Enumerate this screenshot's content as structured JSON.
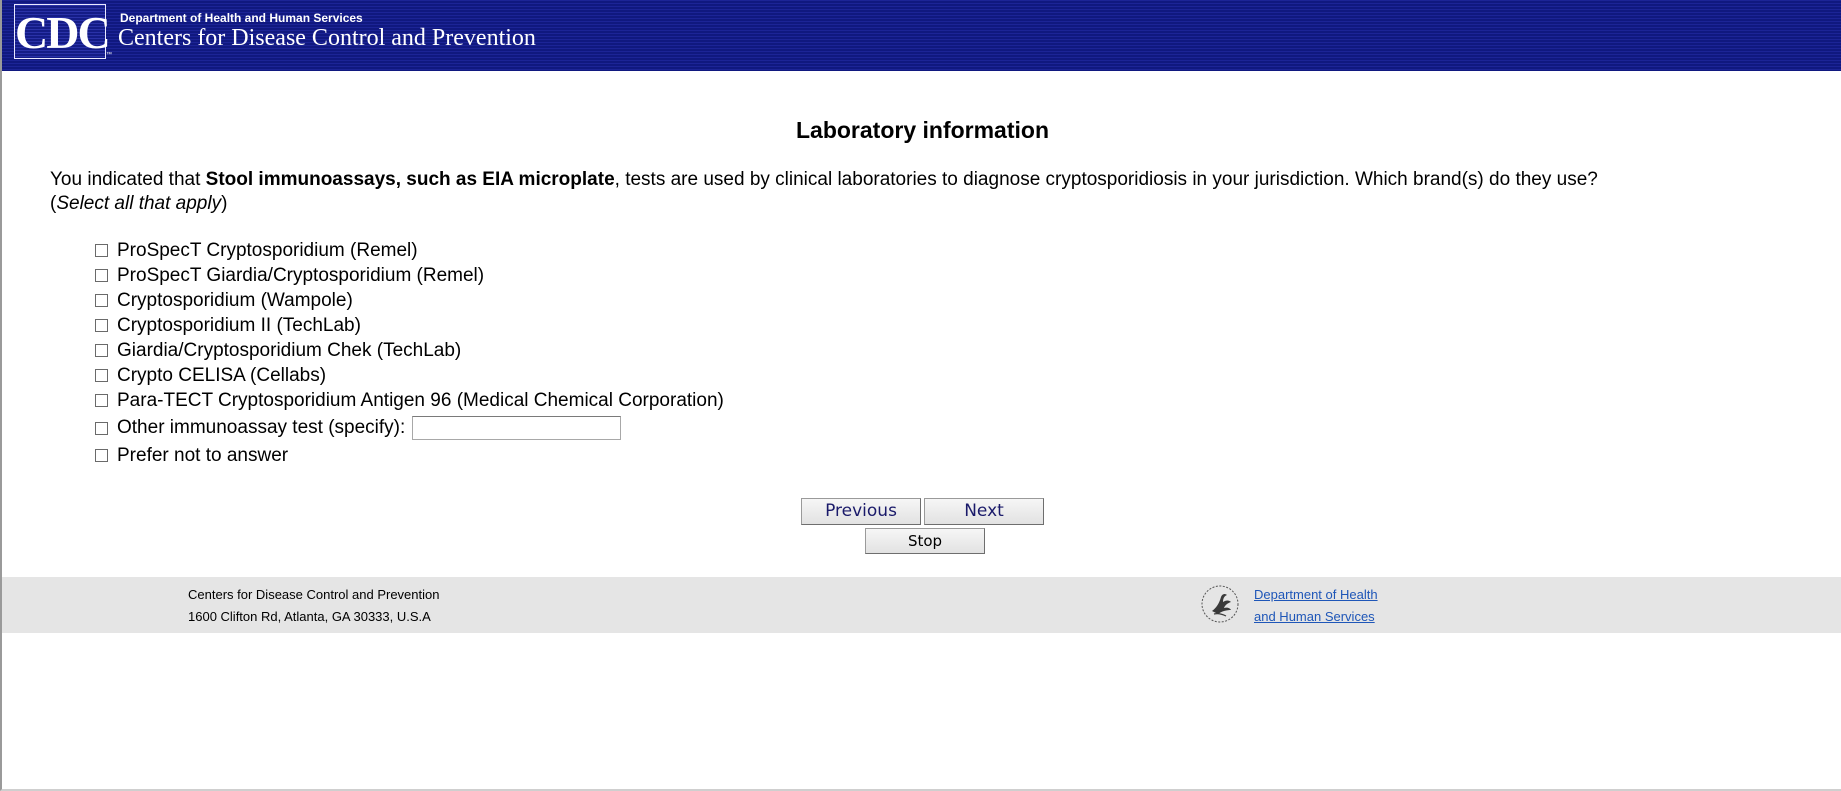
{
  "header": {
    "logo_text": "CDC",
    "logo_mark": "™",
    "department": "Department of Health and Human Services",
    "agency": "Centers for Disease Control and Prevention"
  },
  "page": {
    "title": "Laboratory information"
  },
  "question": {
    "prefix": "You indicated that ",
    "emphasis": "Stool immunoassays, such as EIA microplate",
    "suffix": ", tests are used by clinical laboratories to diagnose cryptosporidiosis in your jurisdiction. Which brand(s) do they use?",
    "instruction_open": "(",
    "instruction": "Select all that apply",
    "instruction_close": ")"
  },
  "options": [
    {
      "label": "ProSpecT Cryptosporidium (Remel)",
      "checked": false
    },
    {
      "label": "ProSpecT Giardia/Cryptosporidium (Remel)",
      "checked": false
    },
    {
      "label": "Cryptosporidium (Wampole)",
      "checked": false
    },
    {
      "label": "Cryptosporidium II (TechLab)",
      "checked": false
    },
    {
      "label": "Giardia/Cryptosporidium Chek (TechLab)",
      "checked": false
    },
    {
      "label": "Crypto CELISA (Cellabs)",
      "checked": false
    },
    {
      "label": "Para-TECT Cryptosporidium Antigen 96 (Medical Chemical Corporation)",
      "checked": false
    },
    {
      "label": "Other immunoassay test (specify):",
      "checked": false,
      "input_value": ""
    },
    {
      "label": "Prefer not to answer",
      "checked": false
    }
  ],
  "buttons": {
    "previous": "Previous",
    "next": "Next",
    "stop": "Stop"
  },
  "footer": {
    "org": "Centers for Disease Control and Prevention",
    "address": "1600 Clifton Rd, Atlanta, GA 30333, U.S.A",
    "hhs_link_line1": "Department of Health",
    "hhs_link_line2": "and Human Services"
  },
  "colors": {
    "header_bg": "#121a8a",
    "footer_bg": "#e5e5e5",
    "link": "#1e56b8",
    "button_text": "#1a1a6a"
  },
  "icons": {
    "header_logo": "cdc-logo",
    "footer_logo": "hhs-eagle-logo",
    "option_box": "checkbox"
  }
}
